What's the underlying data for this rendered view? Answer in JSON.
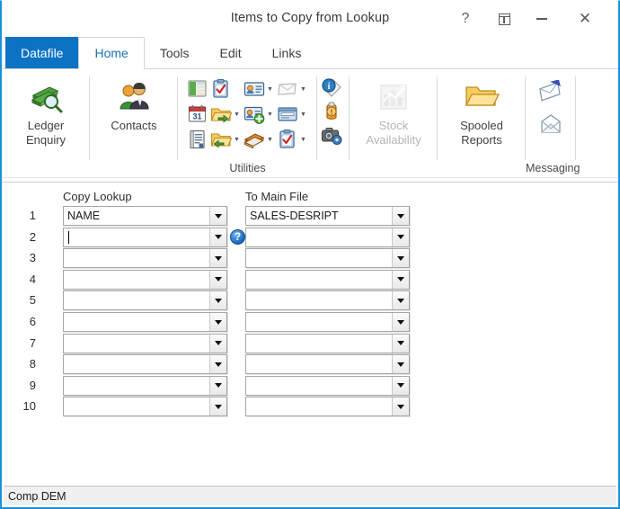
{
  "window": {
    "title": "Items to Copy from Lookup",
    "controls": [
      {
        "name": "help-button",
        "glyph": "?"
      },
      {
        "name": "dock-button",
        "glyph": "dock"
      },
      {
        "name": "minimize-button",
        "glyph": "minimize"
      },
      {
        "name": "close-button",
        "glyph": "✕"
      }
    ],
    "accent_color": "#1f90d8"
  },
  "tabs": [
    {
      "label": "Datafile",
      "style": "datafile",
      "active": false
    },
    {
      "label": "Home",
      "style": "normal",
      "active": true
    },
    {
      "label": "Tools",
      "style": "normal",
      "active": false
    },
    {
      "label": "Edit",
      "style": "normal",
      "active": false
    },
    {
      "label": "Links",
      "style": "normal",
      "active": false
    }
  ],
  "ribbon": {
    "groups": [
      {
        "name": "ledger-enquiry",
        "label_line1": "Ledger",
        "label_line2": "Enquiry",
        "icon": "books-magnifier-icon",
        "disabled": false
      },
      {
        "name": "contacts",
        "label_line1": "Contacts",
        "label_line2": "",
        "icon": "people-contacts-icon",
        "disabled": false
      },
      {
        "name": "stock-availability",
        "label_line1": "Stock",
        "label_line2": "Availability",
        "icon": "bar-chart-icon",
        "disabled": true
      },
      {
        "name": "spooled-reports",
        "label_line1": "Spooled",
        "label_line2": "Reports",
        "icon": "open-folder-icon",
        "disabled": false
      }
    ],
    "utilities": {
      "label": "Utilities",
      "icons": [
        {
          "name": "spreadsheet-icon",
          "caret": false
        },
        {
          "name": "clipboard-check-icon",
          "caret": false
        },
        {
          "name": "contact-card-icon",
          "caret": true
        },
        {
          "name": "envelope-white-icon",
          "caret": true
        },
        {
          "name": "calendar-icon",
          "caret": false
        },
        {
          "name": "folder-out-icon",
          "caret": true
        },
        {
          "name": "contact-add-icon",
          "caret": true
        },
        {
          "name": "window-form-icon",
          "caret": true
        },
        {
          "name": "document-icon",
          "caret": false
        },
        {
          "name": "folder-in-icon",
          "caret": true
        },
        {
          "name": "books-icon",
          "caret": true
        },
        {
          "name": "clipboard-check-2-icon",
          "caret": true
        }
      ]
    },
    "tools_column": [
      {
        "name": "info-tag-icon"
      },
      {
        "name": "alert-person-icon"
      },
      {
        "name": "camera-settings-icon"
      }
    ],
    "messaging": {
      "label": "Messaging",
      "icons": [
        {
          "name": "send-mail-icon"
        },
        {
          "name": "open-mail-icon"
        }
      ]
    }
  },
  "form": {
    "column_headers": {
      "left": "Copy Lookup",
      "right": "To Main File"
    },
    "help_badge": "?",
    "rows": [
      {
        "num": "1",
        "left": "NAME",
        "right": "SALES-DESRIPT",
        "focused": false
      },
      {
        "num": "2",
        "left": "",
        "right": "",
        "focused": true
      },
      {
        "num": "3",
        "left": "",
        "right": "",
        "focused": false
      },
      {
        "num": "4",
        "left": "",
        "right": "",
        "focused": false
      },
      {
        "num": "5",
        "left": "",
        "right": "",
        "focused": false
      },
      {
        "num": "6",
        "left": "",
        "right": "",
        "focused": false
      },
      {
        "num": "7",
        "left": "",
        "right": "",
        "focused": false
      },
      {
        "num": "8",
        "left": "",
        "right": "",
        "focused": false
      },
      {
        "num": "9",
        "left": "",
        "right": "",
        "focused": false
      },
      {
        "num": "10",
        "left": "",
        "right": "",
        "focused": false
      }
    ]
  },
  "statusbar": {
    "text": "Comp DEM"
  }
}
